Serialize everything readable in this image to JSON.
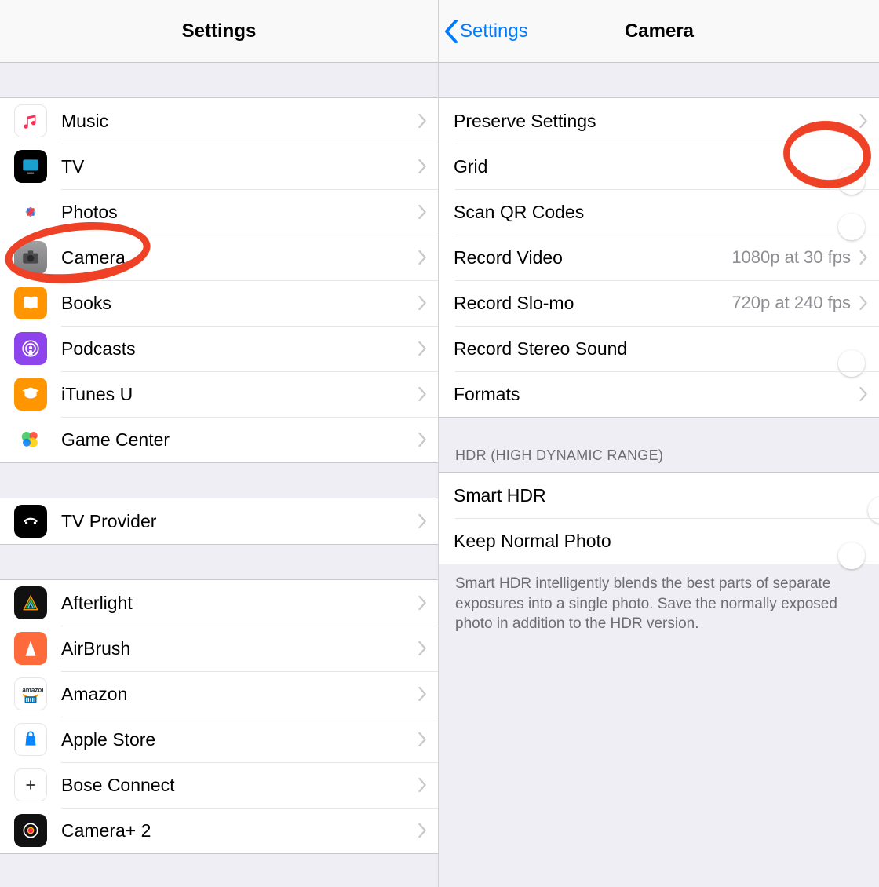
{
  "left": {
    "title": "Settings",
    "group1": [
      {
        "icon": "music",
        "label": "Music"
      },
      {
        "icon": "tv",
        "label": "TV"
      },
      {
        "icon": "photos",
        "label": "Photos"
      },
      {
        "icon": "camera",
        "label": "Camera"
      },
      {
        "icon": "books",
        "label": "Books"
      },
      {
        "icon": "podcasts",
        "label": "Podcasts"
      },
      {
        "icon": "itunesu",
        "label": "iTunes U"
      },
      {
        "icon": "gamecenter",
        "label": "Game Center"
      }
    ],
    "group2": [
      {
        "icon": "tvprov",
        "label": "TV Provider"
      }
    ],
    "group3": [
      {
        "icon": "afterlight",
        "label": "Afterlight"
      },
      {
        "icon": "airbrush",
        "label": "AirBrush"
      },
      {
        "icon": "amazon",
        "label": "Amazon"
      },
      {
        "icon": "applestore",
        "label": "Apple Store"
      },
      {
        "icon": "bose",
        "label": "Bose Connect"
      },
      {
        "icon": "cameraplus",
        "label": "Camera+ 2"
      }
    ]
  },
  "right": {
    "back": "Settings",
    "title": "Camera",
    "rows": {
      "preserve": "Preserve Settings",
      "grid": "Grid",
      "scanqr": "Scan QR Codes",
      "recvideo": "Record Video",
      "recvideo_val": "1080p at 30 fps",
      "recslo": "Record Slo-mo",
      "recslo_val": "720p at 240 fps",
      "stereo": "Record Stereo Sound",
      "formats": "Formats"
    },
    "hdr_header": "HDR (HIGH DYNAMIC RANGE)",
    "hdr": {
      "smart": "Smart HDR",
      "keep": "Keep Normal Photo"
    },
    "footer": "Smart HDR intelligently blends the best parts of separate exposures into a single photo. Save the normally exposed photo in addition to the HDR version.",
    "toggles": {
      "grid": true,
      "scanqr": true,
      "stereo": true,
      "smart": false,
      "keep": true
    }
  }
}
